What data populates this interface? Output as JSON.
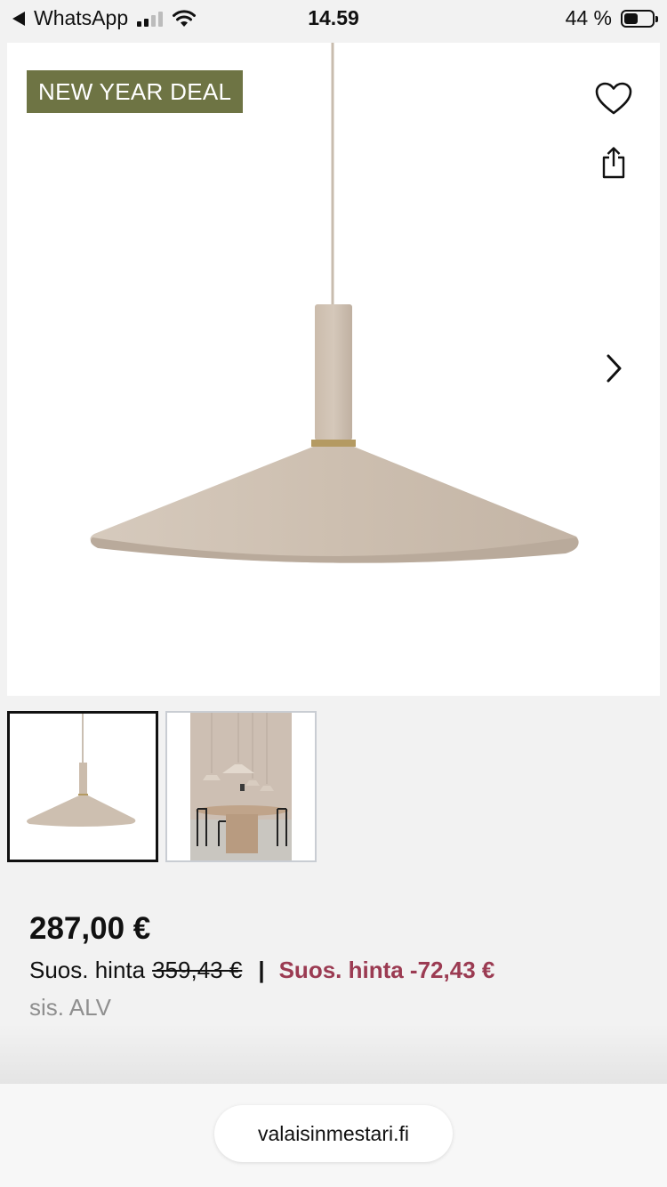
{
  "status_bar": {
    "back_app": "WhatsApp",
    "time": "14.59",
    "battery": "44 %",
    "battery_level": 0.44
  },
  "hero": {
    "badge": "NEW YEAR DEAL",
    "icons": [
      "heart-icon",
      "share-icon",
      "chevron-right-icon"
    ]
  },
  "thumbnails": [
    {
      "name": "lamp-product",
      "selected": true
    },
    {
      "name": "dining-room-scene",
      "selected": false
    }
  ],
  "pricing": {
    "price": "287,00 €",
    "rec_label": "Suos. hinta",
    "old_price": "359,43 €",
    "separator": "|",
    "discount": "Suos. hinta -72,43 €",
    "vat": "sis. ALV"
  },
  "browser": {
    "url": "valaisinmestari.fi"
  },
  "colors": {
    "badge_bg": "#6e7444",
    "discount": "#9b3b52",
    "lamp": "#cdbfb0"
  }
}
